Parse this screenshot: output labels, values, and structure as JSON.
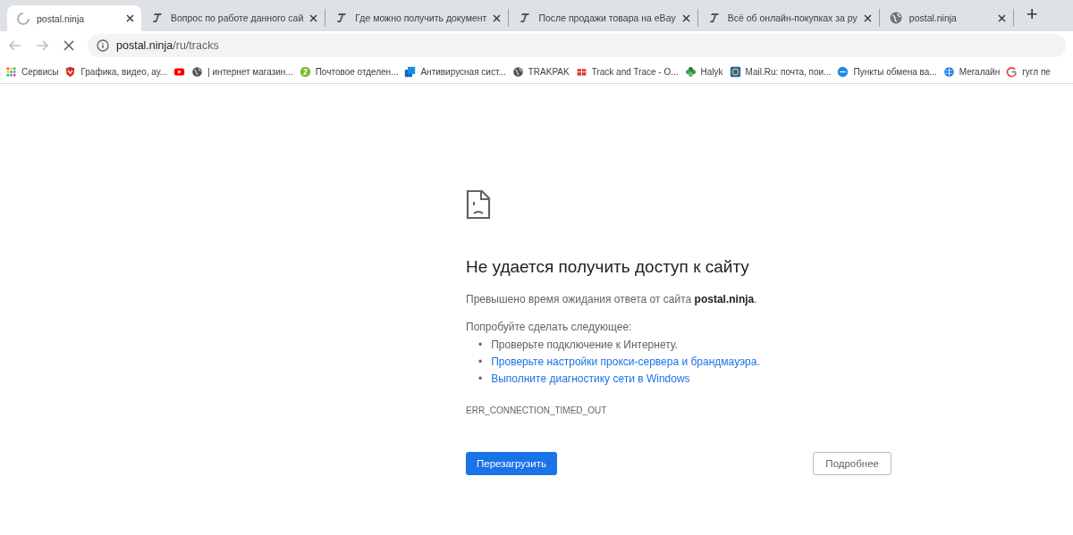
{
  "tabs": [
    {
      "title": "postal.ninja",
      "kind": "spinner",
      "selected": true
    },
    {
      "title": "Вопрос по работе данного сай",
      "kind": "feather",
      "selected": false
    },
    {
      "title": "Где можно получить документ",
      "kind": "feather",
      "selected": false
    },
    {
      "title": "После продажи товара на eBay",
      "kind": "feather",
      "selected": false
    },
    {
      "title": "Всё об онлайн-покупках за ру",
      "kind": "feather",
      "selected": false
    },
    {
      "title": "postal.ninja",
      "kind": "globe",
      "selected": false
    }
  ],
  "new_tab": "+",
  "address": {
    "host": "postal.ninja",
    "path": "/ru/tracks"
  },
  "bookmarks": [
    {
      "label": "Сервисы",
      "kind": "apps"
    },
    {
      "label": "Графика, видео, ау...",
      "kind": "shield"
    },
    {
      "kind": "youtube"
    },
    {
      "label": "| интернет магазин...",
      "kind": "globe"
    },
    {
      "label": "Почтовое отделен...",
      "kind": "green2"
    },
    {
      "label": "Антивирусная сист...",
      "kind": "squares"
    },
    {
      "label": "TRAKPAK",
      "kind": "globe"
    },
    {
      "label": "Track and Trace - O...",
      "kind": "redpost"
    },
    {
      "label": "Halyk",
      "kind": "clover"
    },
    {
      "label": "Mail.Ru: почта, пои...",
      "kind": "mail"
    },
    {
      "label": "Пункты обмена ва...",
      "kind": "bluecircle"
    },
    {
      "label": "Мегалайн",
      "kind": "globeblue"
    },
    {
      "label": "гугл пе",
      "kind": "google"
    }
  ],
  "error": {
    "heading": "Не удается получить доступ к сайту",
    "message": "Превышено время ожидания ответа от сайта **postal.ninja**.",
    "suggestions_title": "Попробуйте сделать следующее:",
    "suggestions": [
      {
        "bullet": "•",
        "text": "Проверьте подключение к Интернету.",
        "kind": "text"
      },
      {
        "bullet": "•",
        "text": "Проверьте настройки прокси-сервера и брандмауэра.",
        "kind": "link"
      },
      {
        "bullet": "•",
        "text": "Выполните диагностику сети в Windows",
        "kind": "link"
      }
    ],
    "code": "ERR_CONNECTION_TIMED_OUT",
    "reload_button": "Перезагрузить",
    "details_button": "Подробнее"
  }
}
